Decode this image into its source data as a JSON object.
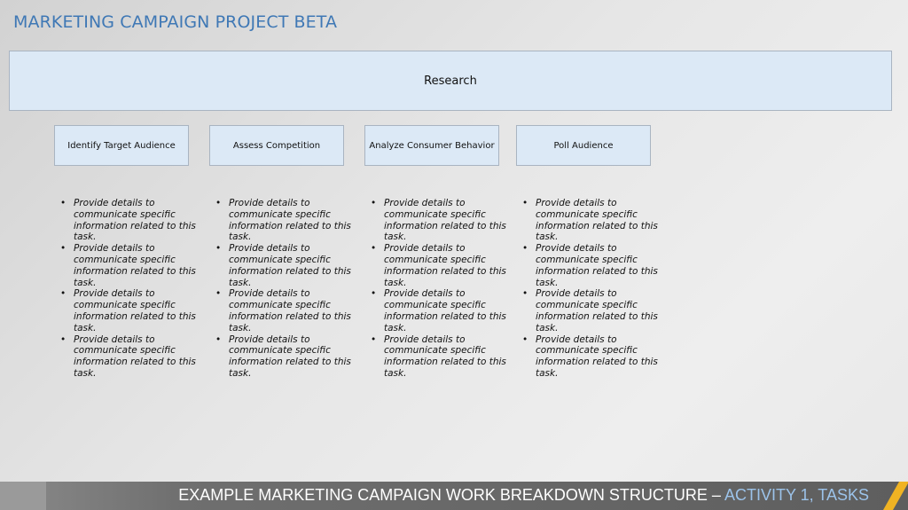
{
  "title": "MARKETING CAMPAIGN PROJECT BETA",
  "root": {
    "label": "Research"
  },
  "tasks": [
    {
      "label": "Identify Target Audience",
      "details": [
        "Provide details to communicate specific information related to this task.",
        "Provide details to communicate specific information related to this task.",
        "Provide details to communicate specific information related to this task.",
        "Provide details to communicate specific information related to this task."
      ]
    },
    {
      "label": "Assess Competition",
      "details": [
        "Provide details to communicate specific information related to this task.",
        "Provide details to communicate specific information related to this task.",
        "Provide details to communicate specific information related to this task.",
        "Provide details to communicate specific information related to this task."
      ]
    },
    {
      "label": "Analyze Consumer Behavior",
      "details": [
        "Provide details to communicate specific information related to this task.",
        "Provide details to communicate specific information related to this task.",
        "Provide details to communicate specific information related to this task.",
        "Provide details to communicate specific information related to this task."
      ]
    },
    {
      "label": "Poll Audience",
      "details": [
        "Provide details to communicate specific information related to this task.",
        "Provide details to communicate specific information related to this task.",
        "Provide details to communicate specific information related to this task.",
        "Provide details to communicate specific information related to this task."
      ]
    }
  ],
  "footer": {
    "main": "EXAMPLE MARKETING CAMPAIGN WORK BREAKDOWN STRUCTURE – ",
    "highlight": "ACTIVITY 1, TASKS"
  },
  "colors": {
    "title": "#3f78b5",
    "box_fill": "#dce9f6",
    "box_border": "#a9b4c1",
    "footer_highlight": "#9cc3ea",
    "accent": "#f0b323"
  }
}
